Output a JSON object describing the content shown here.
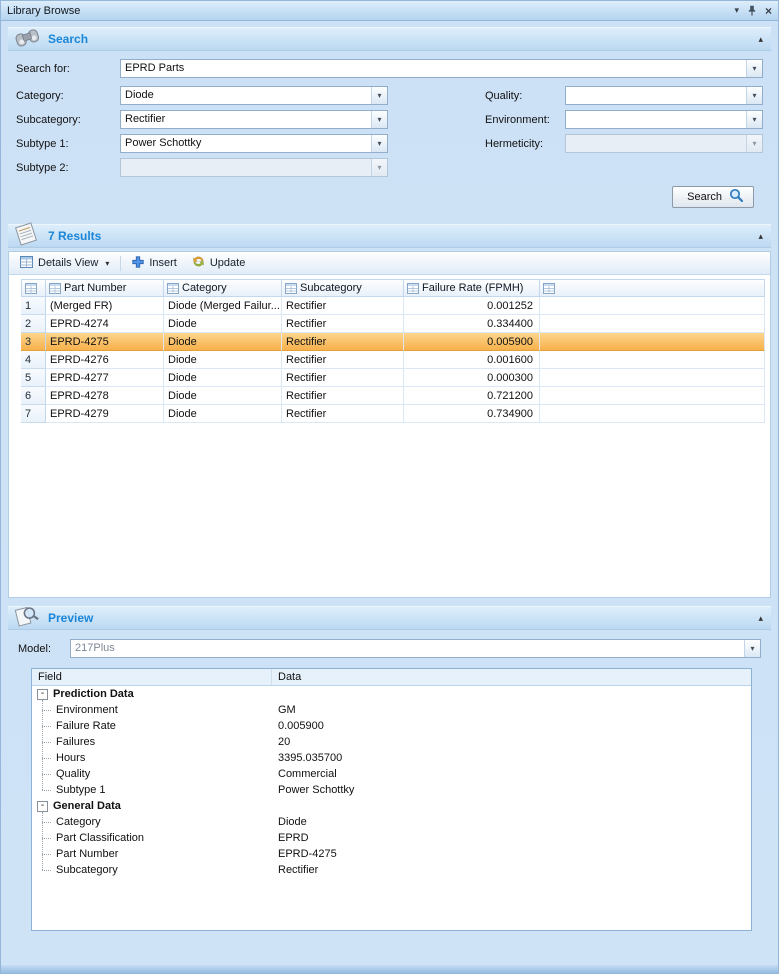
{
  "window": {
    "title": "Library Browse"
  },
  "icons": {
    "dropdown": "▾",
    "collapse": "▴",
    "close": "×",
    "minus": "-"
  },
  "search": {
    "header": "Search",
    "search_for_label": "Search for:",
    "search_for_value": "EPRD Parts",
    "category_label": "Category:",
    "category_value": "Diode",
    "subcategory_label": "Subcategory:",
    "subcategory_value": "Rectifier",
    "subtype1_label": "Subtype 1:",
    "subtype1_value": "Power Schottky",
    "subtype2_label": "Subtype 2:",
    "subtype2_value": "",
    "quality_label": "Quality:",
    "quality_value": "",
    "environment_label": "Environment:",
    "environment_value": "",
    "hermeticity_label": "Hermeticity:",
    "hermeticity_value": "",
    "search_button": "Search"
  },
  "results": {
    "header": "7 Results",
    "toolbar": {
      "details_view": "Details View",
      "insert": "Insert",
      "update": "Update"
    },
    "columns": {
      "part_number": "Part Number",
      "category": "Category",
      "subcategory": "Subcategory",
      "failure_rate": "Failure Rate (FPMH)"
    },
    "selected_row_index": 2,
    "rows": [
      {
        "num": "1",
        "part_number": "(Merged FR)",
        "category": "Diode (Merged Failur...",
        "subcategory": "Rectifier",
        "failure_rate": "0.001252"
      },
      {
        "num": "2",
        "part_number": "EPRD-4274",
        "category": "Diode",
        "subcategory": "Rectifier",
        "failure_rate": "0.334400"
      },
      {
        "num": "3",
        "part_number": "EPRD-4275",
        "category": "Diode",
        "subcategory": "Rectifier",
        "failure_rate": "0.005900"
      },
      {
        "num": "4",
        "part_number": "EPRD-4276",
        "category": "Diode",
        "subcategory": "Rectifier",
        "failure_rate": "0.001600"
      },
      {
        "num": "5",
        "part_number": "EPRD-4277",
        "category": "Diode",
        "subcategory": "Rectifier",
        "failure_rate": "0.000300"
      },
      {
        "num": "6",
        "part_number": "EPRD-4278",
        "category": "Diode",
        "subcategory": "Rectifier",
        "failure_rate": "0.721200"
      },
      {
        "num": "7",
        "part_number": "EPRD-4279",
        "category": "Diode",
        "subcategory": "Rectifier",
        "failure_rate": "0.734900"
      }
    ]
  },
  "preview": {
    "header": "Preview",
    "model_label": "Model:",
    "model_value": "217Plus",
    "field_column": "Field",
    "data_column": "Data",
    "groups": [
      {
        "label": "Prediction Data",
        "items": [
          {
            "field": "Environment",
            "data": "GM"
          },
          {
            "field": "Failure Rate",
            "data": "0.005900"
          },
          {
            "field": "Failures",
            "data": "20"
          },
          {
            "field": "Hours",
            "data": "3395.035700"
          },
          {
            "field": "Quality",
            "data": "Commercial"
          },
          {
            "field": "Subtype 1",
            "data": "Power Schottky"
          }
        ]
      },
      {
        "label": "General Data",
        "items": [
          {
            "field": "Category",
            "data": "Diode"
          },
          {
            "field": "Part Classification",
            "data": "EPRD"
          },
          {
            "field": "Part Number",
            "data": "EPRD-4275"
          },
          {
            "field": "Subcategory",
            "data": "Rectifier"
          }
        ]
      }
    ]
  }
}
